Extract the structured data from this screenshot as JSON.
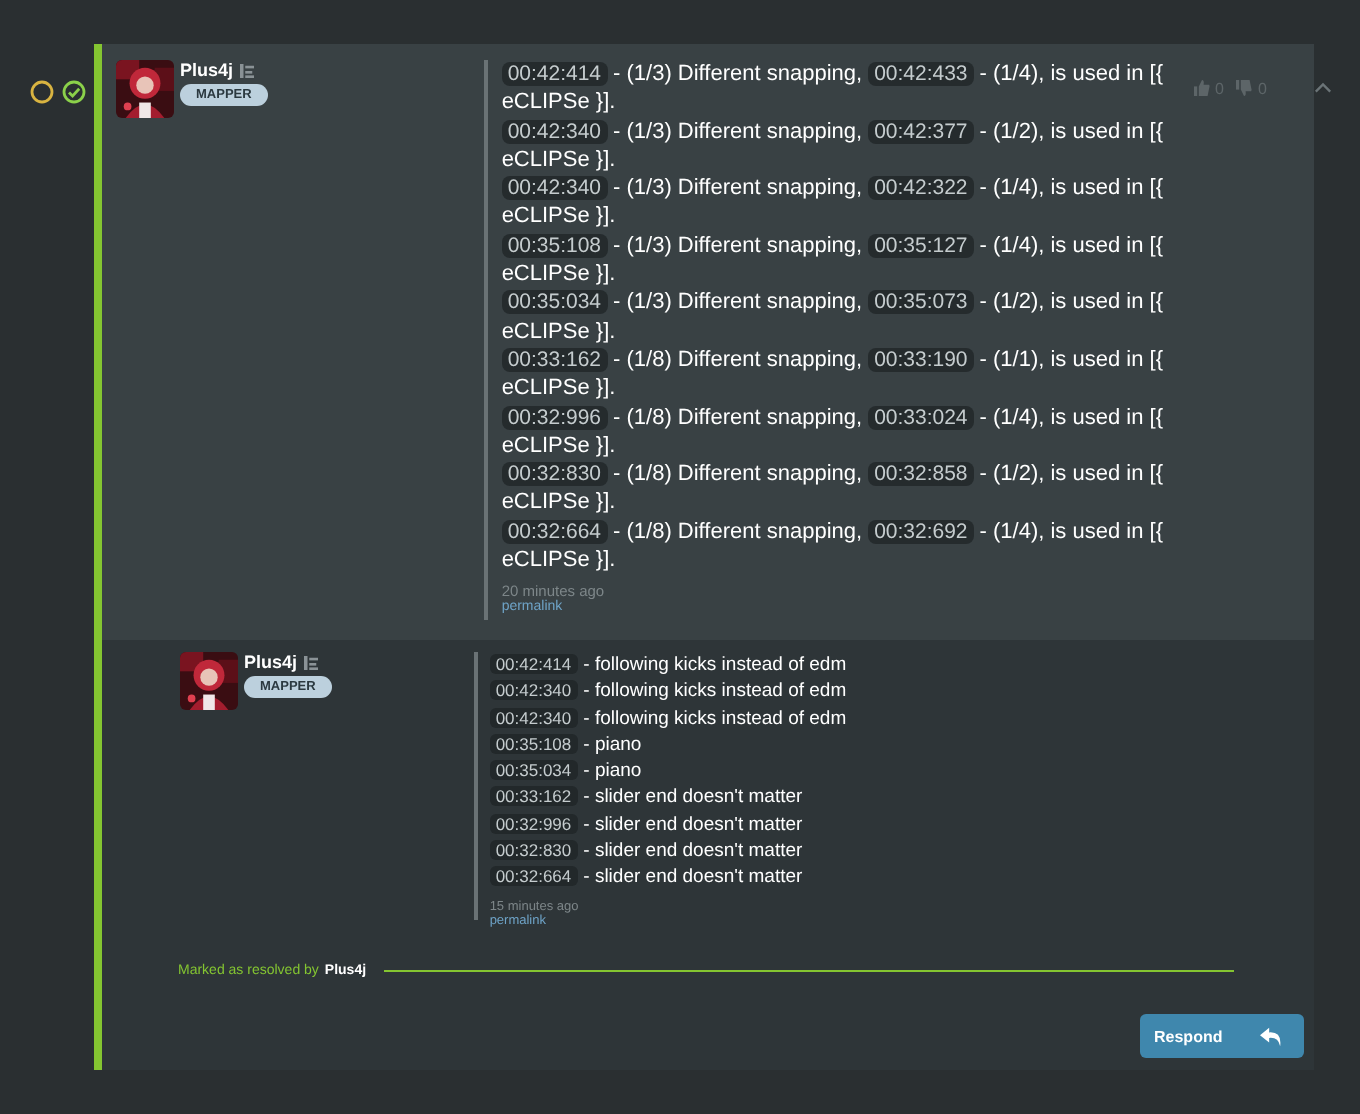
{
  "status": {
    "pending": false,
    "resolved": true
  },
  "post": {
    "author": "Plus4j",
    "badge": "MAPPER",
    "votes_up": "0",
    "votes_down": "0",
    "expanded": true,
    "messages": [
      {
        "parts": [
          {
            "kind": "time",
            "text": "00:42:414"
          },
          {
            "kind": "text",
            "text": "- (1/3) Different snapping,"
          },
          {
            "kind": "time",
            "text": "00:42:433"
          },
          {
            "kind": "text",
            "text": "- (1/4), is used in [{"
          }
        ],
        "continuation": "eCLIPSe }]."
      },
      {
        "parts": [
          {
            "kind": "time",
            "text": "00:42:340"
          },
          {
            "kind": "text",
            "text": "- (1/3) Different snapping,"
          },
          {
            "kind": "time",
            "text": "00:42:377"
          },
          {
            "kind": "text",
            "text": "- (1/2), is used in [{"
          }
        ],
        "continuation": "eCLIPSe }]."
      },
      {
        "parts": [
          {
            "kind": "time",
            "text": "00:42:340"
          },
          {
            "kind": "text",
            "text": "- (1/3) Different snapping,"
          },
          {
            "kind": "time",
            "text": "00:42:322"
          },
          {
            "kind": "text",
            "text": "- (1/4), is used in [{"
          }
        ],
        "continuation": "eCLIPSe }]."
      },
      {
        "parts": [
          {
            "kind": "time",
            "text": "00:35:108"
          },
          {
            "kind": "text",
            "text": "- (1/3) Different snapping,"
          },
          {
            "kind": "time",
            "text": "00:35:127"
          },
          {
            "kind": "text",
            "text": "- (1/4), is used in [{"
          }
        ],
        "continuation": "eCLIPSe }]."
      },
      {
        "parts": [
          {
            "kind": "time",
            "text": "00:35:034"
          },
          {
            "kind": "text",
            "text": "- (1/3) Different snapping,"
          },
          {
            "kind": "time",
            "text": "00:35:073"
          },
          {
            "kind": "text",
            "text": "- (1/2), is used in [{"
          }
        ],
        "continuation": "eCLIPSe }]."
      },
      {
        "parts": [
          {
            "kind": "time",
            "text": "00:33:162"
          },
          {
            "kind": "text",
            "text": "- (1/8) Different snapping,"
          },
          {
            "kind": "time",
            "text": "00:33:190"
          },
          {
            "kind": "text",
            "text": "- (1/1), is used in [{"
          }
        ],
        "continuation": "eCLIPSe }]."
      },
      {
        "parts": [
          {
            "kind": "time",
            "text": "00:32:996"
          },
          {
            "kind": "text",
            "text": "- (1/8) Different snapping,"
          },
          {
            "kind": "time",
            "text": "00:33:024"
          },
          {
            "kind": "text",
            "text": "- (1/4), is used in [{"
          }
        ],
        "continuation": "eCLIPSe }]."
      },
      {
        "parts": [
          {
            "kind": "time",
            "text": "00:32:830"
          },
          {
            "kind": "text",
            "text": "- (1/8) Different snapping,"
          },
          {
            "kind": "time",
            "text": "00:32:858"
          },
          {
            "kind": "text",
            "text": "- (1/2), is used in [{"
          }
        ],
        "continuation": "eCLIPSe }]."
      },
      {
        "parts": [
          {
            "kind": "time",
            "text": "00:32:664"
          },
          {
            "kind": "text",
            "text": "- (1/8) Different snapping,"
          },
          {
            "kind": "time",
            "text": "00:32:692"
          },
          {
            "kind": "text",
            "text": "- (1/4), is used in [{"
          }
        ],
        "continuation": "eCLIPSe }]."
      }
    ],
    "time_ago": "20 minutes ago",
    "permalink": "permalink"
  },
  "reply": {
    "author": "Plus4j",
    "badge": "MAPPER",
    "messages": [
      {
        "parts": [
          {
            "kind": "time",
            "text": "00:42:414"
          },
          {
            "kind": "text",
            "text": "- following kicks instead of edm"
          }
        ]
      },
      {
        "parts": [
          {
            "kind": "time",
            "text": "00:42:340"
          },
          {
            "kind": "text",
            "text": "- following kicks instead of edm"
          }
        ]
      },
      {
        "parts": [
          {
            "kind": "time",
            "text": "00:42:340"
          },
          {
            "kind": "text",
            "text": "- following kicks instead of edm"
          }
        ]
      },
      {
        "parts": [
          {
            "kind": "time",
            "text": "00:35:108"
          },
          {
            "kind": "text",
            "text": "- piano"
          }
        ]
      },
      {
        "parts": [
          {
            "kind": "time",
            "text": "00:35:034"
          },
          {
            "kind": "text",
            "text": "- piano"
          }
        ]
      },
      {
        "parts": [
          {
            "kind": "time",
            "text": "00:33:162"
          },
          {
            "kind": "text",
            "text": "- slider end doesn't matter"
          }
        ]
      },
      {
        "parts": [
          {
            "kind": "time",
            "text": "00:32:996"
          },
          {
            "kind": "text",
            "text": "- slider end doesn't matter"
          }
        ]
      },
      {
        "parts": [
          {
            "kind": "time",
            "text": "00:32:830"
          },
          {
            "kind": "text",
            "text": "- slider end doesn't matter"
          }
        ]
      },
      {
        "parts": [
          {
            "kind": "time",
            "text": "00:32:664"
          },
          {
            "kind": "text",
            "text": "- slider end doesn't matter"
          }
        ]
      }
    ],
    "time_ago": "15 minutes ago",
    "permalink": "permalink"
  },
  "resolution": {
    "label": "Marked as resolved by",
    "user": "Plus4j"
  },
  "respond_button": "Respond"
}
